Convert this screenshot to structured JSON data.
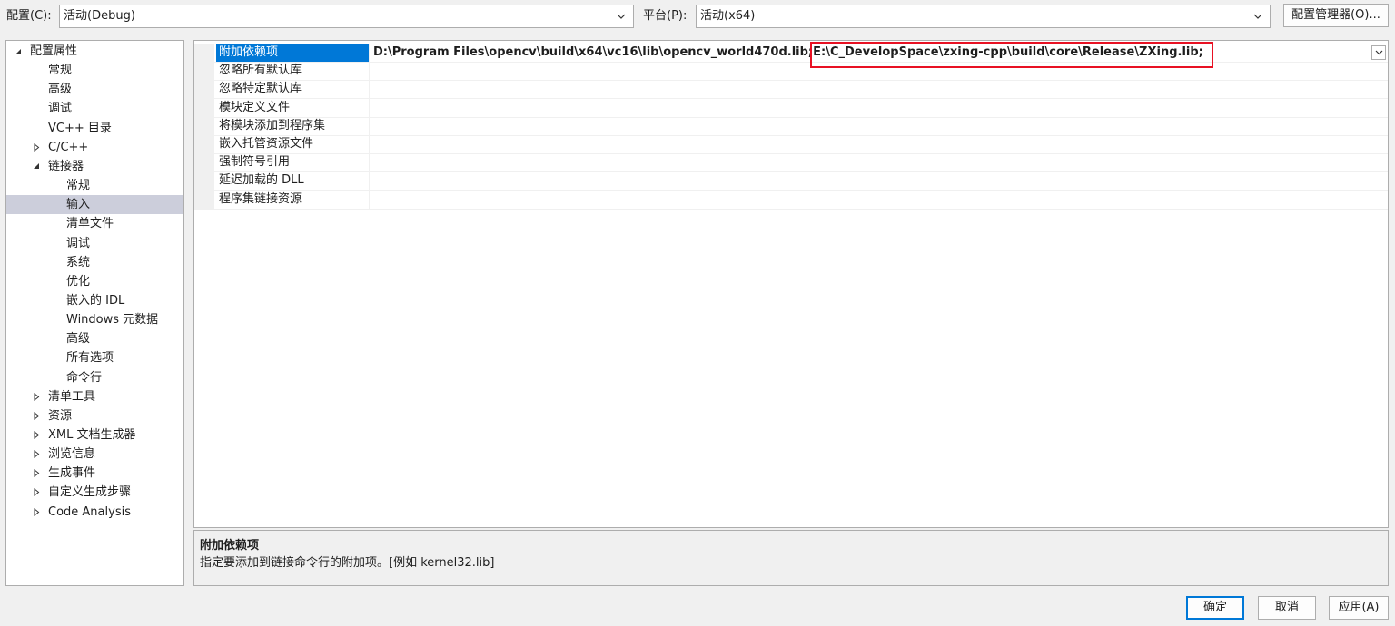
{
  "config_bar": {
    "config_label": "配置(C):",
    "config_value": "活动(Debug)",
    "platform_label": "平台(P):",
    "platform_value": "活动(x64)",
    "manager_button": "配置管理器(O)..."
  },
  "tree": [
    {
      "label": "配置属性",
      "level": 0,
      "toggle": "expanded"
    },
    {
      "label": "常规",
      "level": 1,
      "toggle": "none"
    },
    {
      "label": "高级",
      "level": 1,
      "toggle": "none"
    },
    {
      "label": "调试",
      "level": 1,
      "toggle": "none"
    },
    {
      "label": "VC++ 目录",
      "level": 1,
      "toggle": "none"
    },
    {
      "label": "C/C++",
      "level": 1,
      "toggle": "collapsed"
    },
    {
      "label": "链接器",
      "level": 1,
      "toggle": "expanded"
    },
    {
      "label": "常规",
      "level": 2,
      "toggle": "none"
    },
    {
      "label": "输入",
      "level": 2,
      "toggle": "none",
      "selected": true
    },
    {
      "label": "清单文件",
      "level": 2,
      "toggle": "none"
    },
    {
      "label": "调试",
      "level": 2,
      "toggle": "none"
    },
    {
      "label": "系统",
      "level": 2,
      "toggle": "none"
    },
    {
      "label": "优化",
      "level": 2,
      "toggle": "none"
    },
    {
      "label": "嵌入的 IDL",
      "level": 2,
      "toggle": "none"
    },
    {
      "label": "Windows 元数据",
      "level": 2,
      "toggle": "none"
    },
    {
      "label": "高级",
      "level": 2,
      "toggle": "none"
    },
    {
      "label": "所有选项",
      "level": 2,
      "toggle": "none"
    },
    {
      "label": "命令行",
      "level": 2,
      "toggle": "none"
    },
    {
      "label": "清单工具",
      "level": 1,
      "toggle": "collapsed"
    },
    {
      "label": "资源",
      "level": 1,
      "toggle": "collapsed"
    },
    {
      "label": "XML 文档生成器",
      "level": 1,
      "toggle": "collapsed"
    },
    {
      "label": "浏览信息",
      "level": 1,
      "toggle": "collapsed"
    },
    {
      "label": "生成事件",
      "level": 1,
      "toggle": "collapsed"
    },
    {
      "label": "自定义生成步骤",
      "level": 1,
      "toggle": "collapsed"
    },
    {
      "label": "Code Analysis",
      "level": 1,
      "toggle": "collapsed"
    }
  ],
  "properties": [
    {
      "name": "附加依赖项",
      "selected": true,
      "value_part1": "D:\\Program Files\\opencv\\build\\x64\\vc16\\lib\\opencv_world470d.lib;",
      "value_part2": "E:\\C_DevelopSpace\\zxing-cpp\\build\\core\\Release\\ZXing.lib;"
    },
    {
      "name": "忽略所有默认库",
      "value": ""
    },
    {
      "name": "忽略特定默认库",
      "value": ""
    },
    {
      "name": "模块定义文件",
      "value": ""
    },
    {
      "name": "将模块添加到程序集",
      "value": ""
    },
    {
      "name": "嵌入托管资源文件",
      "value": ""
    },
    {
      "name": "强制符号引用",
      "value": ""
    },
    {
      "name": "延迟加载的 DLL",
      "value": ""
    },
    {
      "name": "程序集链接资源",
      "value": ""
    }
  ],
  "description": {
    "title": "附加依赖项",
    "text": "指定要添加到链接命令行的附加项。[例如 kernel32.lib]"
  },
  "buttons": {
    "ok": "确定",
    "cancel": "取消",
    "apply": "应用(A)"
  },
  "colors": {
    "selection_blue": "#0078d7",
    "tree_selection": "#cccedb",
    "highlight_red": "#e81123"
  }
}
